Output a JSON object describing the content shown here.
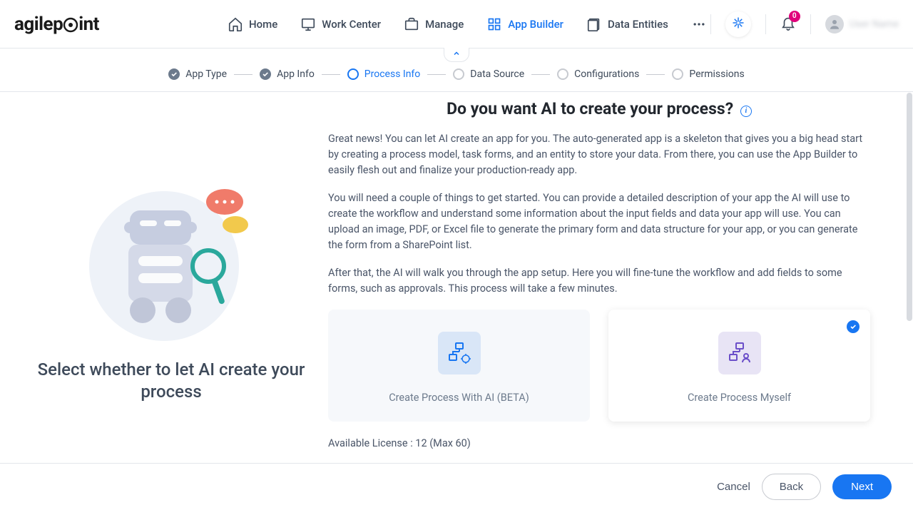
{
  "header": {
    "logo": "agilepoint",
    "nav": [
      {
        "label": "Home",
        "icon": "home"
      },
      {
        "label": "Work Center",
        "icon": "monitor"
      },
      {
        "label": "Manage",
        "icon": "briefcase"
      },
      {
        "label": "App Builder",
        "icon": "grid",
        "active": true
      },
      {
        "label": "Data Entities",
        "icon": "entities"
      }
    ],
    "notif_count": "0",
    "username": "User Name"
  },
  "stepper": [
    {
      "label": "App Type",
      "state": "done"
    },
    {
      "label": "App Info",
      "state": "done"
    },
    {
      "label": "Process Info",
      "state": "current"
    },
    {
      "label": "Data Source",
      "state": "pending"
    },
    {
      "label": "Configurations",
      "state": "pending"
    },
    {
      "label": "Permissions",
      "state": "pending"
    }
  ],
  "left_caption": "Select whether to let AI create your process",
  "main": {
    "title": "Do you want AI to create your process?",
    "para1": "Great news! You can let AI create an app for you. The auto-generated app is a skeleton that gives you a big head start by creating a process model, task forms, and an entity to store your data. From there, you can use the App Builder to easily flesh out and finalize your production-ready app.",
    "para2": "You will need a couple of things to get started. You can provide a detailed description of your app the AI will use to create the workflow and understand some information about the input fields and data your app will use. You can upload an image, PDF, or Excel file to generate the primary form and data structure for your app, or you can generate the form from a SharePoint list.",
    "para3": "After that, the AI will walk you through the app setup. Here you will fine-tune the workflow and add fields to some forms, such as approvals. This process will take a few minutes.",
    "card_ai": "Create Process With AI (BETA)",
    "card_self": "Create Process Myself",
    "license_line": "Available License : 12 (Max 60)"
  },
  "footer": {
    "cancel": "Cancel",
    "back": "Back",
    "next": "Next"
  }
}
